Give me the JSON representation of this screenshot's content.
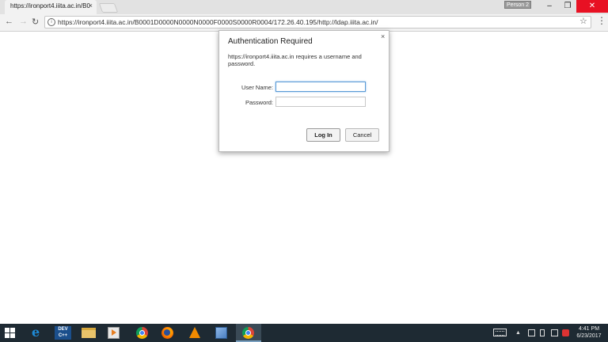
{
  "browser": {
    "tab_title": "https://ironport4.iiita.ac.in/B0",
    "tab_close": "×",
    "profile_label": "Person 2",
    "address": "https://ironport4.iiita.ac.in/B0001D0000N0000N0000F0000S0000R0004/172.26.40.195/http://ldap.iiita.ac.in/",
    "icons": [
      "back-icon",
      "forward-icon",
      "reload-icon",
      "info-icon",
      "star-icon",
      "menu-icon"
    ]
  },
  "dialog": {
    "title": "Authentication Required",
    "message": "https://ironport4.iiita.ac.in requires a username and password.",
    "username_label": "User Name:",
    "password_label": "Password:",
    "username_value": "",
    "password_value": "",
    "login_label": "Log In",
    "cancel_label": "Cancel",
    "close": "×"
  },
  "taskbar": {
    "dev_label": "DEV\nC++",
    "clock_time": "4:41 PM",
    "clock_date": "6/23/2017",
    "apps": [
      "windows-start-icon",
      "internet-explorer-icon",
      "dev-cpp-icon",
      "file-explorer-icon",
      "media-player-icon",
      "chrome-icon",
      "firefox-icon",
      "vlc-icon",
      "notebook-icon",
      "chrome-active-icon"
    ]
  },
  "colors": {
    "taskbar_bg": "#1e2a33",
    "close_red": "#e81123",
    "focus_blue": "#5b9bd5"
  }
}
